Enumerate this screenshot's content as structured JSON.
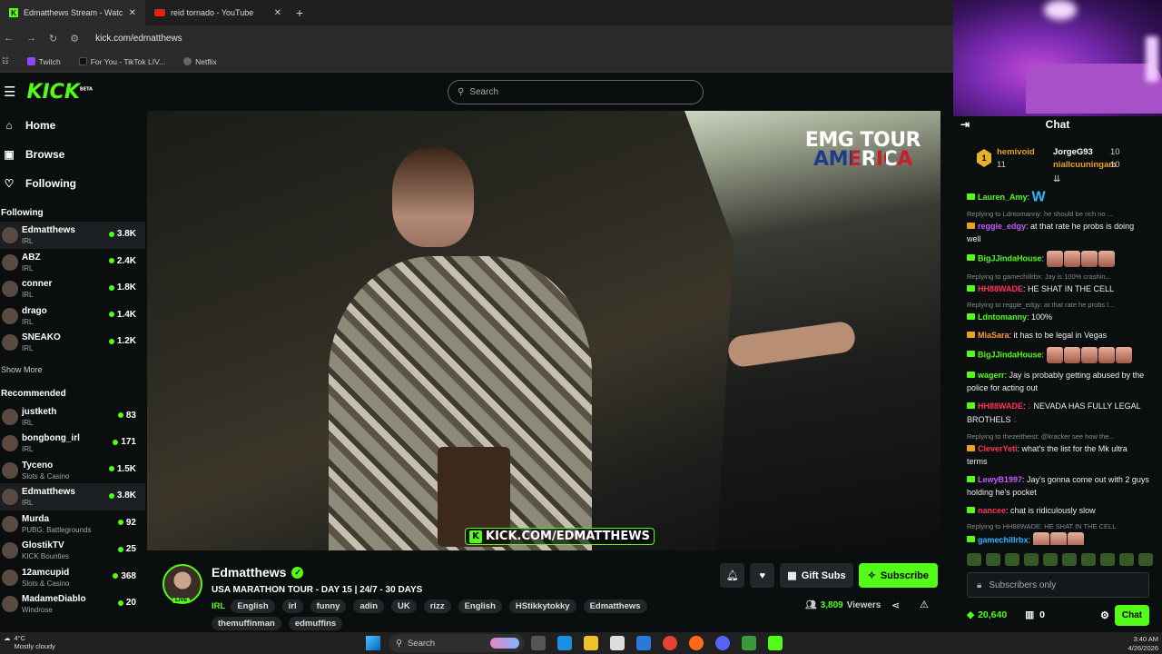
{
  "browser": {
    "tabs": [
      {
        "title": "Edmatthews Stream - Watc",
        "active": true
      },
      {
        "title": "reid tornado - YouTube",
        "active": false
      }
    ],
    "url": "kick.com/edmatthews",
    "bookmarks": [
      "Twitch",
      "For You - TikTok LIV...",
      "Netflix"
    ]
  },
  "kick": {
    "logo": "KICK",
    "logo_sup": "BETA",
    "search_placeholder": "Search"
  },
  "sidebar": {
    "nav": [
      {
        "label": "Home",
        "icon": "home-icon"
      },
      {
        "label": "Browse",
        "icon": "browse-icon"
      },
      {
        "label": "Following",
        "icon": "heart-icon"
      }
    ],
    "following_header": "Following",
    "following": [
      {
        "name": "Edmatthews",
        "category": "IRL",
        "viewers": "3.8K",
        "selected": true
      },
      {
        "name": "ABZ",
        "category": "IRL",
        "viewers": "2.4K"
      },
      {
        "name": "conner",
        "category": "IRL",
        "viewers": "1.8K"
      },
      {
        "name": "drago",
        "category": "IRL",
        "viewers": "1.4K"
      },
      {
        "name": "SNEAKO",
        "category": "IRL",
        "viewers": "1.2K"
      }
    ],
    "show_more": "Show More",
    "recommended_header": "Recommended",
    "recommended": [
      {
        "name": "justketh",
        "category": "IRL",
        "viewers": "83"
      },
      {
        "name": "bongbong_irl",
        "category": "IRL",
        "viewers": "171"
      },
      {
        "name": "Tyceno",
        "category": "Slots & Casino",
        "viewers": "1.5K"
      },
      {
        "name": "Edmatthews",
        "category": "IRL",
        "viewers": "3.8K",
        "selected": true
      },
      {
        "name": "Murda",
        "category": "PUBG: Battlegrounds",
        "viewers": "92"
      },
      {
        "name": "GlostikTV",
        "category": "KICK Bounties",
        "viewers": "25"
      },
      {
        "name": "12amcupid",
        "category": "Slots & Casino",
        "viewers": "368"
      },
      {
        "name": "MadameDiablo",
        "category": "Windrose",
        "viewers": "20"
      }
    ]
  },
  "video": {
    "overlay_line1": "EMG TOUR",
    "overlay_line2": "AMERICA",
    "watermark": "KICK.COM/EDMATTHEWS"
  },
  "channel": {
    "name": "Edmatthews",
    "live_badge": "LIVE",
    "stream_title": "USA MARATHON TOUR  - DAY 15 | 24/7 - 30 DAYS",
    "category": "IRL",
    "tags": [
      "English",
      "irl",
      "funny",
      "adin",
      "UK",
      "rizz",
      "English",
      "HStikkytokky",
      "Edmatthews",
      "themuffinman",
      "edmuffins"
    ],
    "viewers": "3,809",
    "viewers_label": "Viewers",
    "gift_label": "Gift Subs",
    "subscribe_label": "Subscribe"
  },
  "chat": {
    "title": "Chat",
    "leaderboard": [
      {
        "rank": "1",
        "user": "hemivoid",
        "count": "11"
      },
      {
        "user": "JorgeG93",
        "count": "10"
      },
      {
        "user": "niallcuuningam",
        "count": "10"
      }
    ],
    "messages": [
      {
        "user": "Lauren_Amy",
        "color": "#53fc18",
        "text": "",
        "emote": "W"
      },
      {
        "reply": "Replying to Ldntomanny: he should be rich no ...",
        "user": "reggie_edgy",
        "color": "#c45cff",
        "text": "at that rate he probs is doing well"
      },
      {
        "user": "BigJJindaHouse",
        "color": "#53fc18",
        "text": "",
        "emotes": 4
      },
      {
        "reply": "Replying to gamechillrbx: Jay is 100% crashin...",
        "user": "HH88WADE",
        "color": "#ff3355",
        "text": "HE SHAT IN THE CELL"
      },
      {
        "reply": "Replying to reggie_edgy: at that rate he probs l...",
        "user": "Ldntomanny",
        "color": "#53fc18",
        "text": "100%"
      },
      {
        "user": "MiaSara",
        "color": "#ff9a3c",
        "text": "it has to be legal in Vegas"
      },
      {
        "user": "BigJJindaHouse",
        "color": "#53fc18",
        "text": "",
        "emotes": 5
      },
      {
        "user": "wagerr",
        "color": "#53fc18",
        "text": "Jay is probably getting abused by the police for acting out"
      },
      {
        "user": "HH88WADE",
        "color": "#ff3355",
        "text": "NEVADA HAS FULLY LEGAL BROTHELS",
        "drops": true
      },
      {
        "reply": "Replying to thezeitheist: @kracker see how the...",
        "user": "CleverYeti",
        "color": "#ff3355",
        "text": "what's the list for the Mk ultra terms"
      },
      {
        "user": "LewyB1997",
        "color": "#c45cff",
        "text": "Jay's gonna come out with 2 guys holding he's pocket"
      },
      {
        "user": "nancee",
        "color": "#ff3355",
        "text": "chat is ridiculously slow"
      },
      {
        "reply": "Replying to HH88WADE: HE SHAT IN THE CELL",
        "user": "gamechillrbx",
        "color": "#2db8ff",
        "text": "",
        "emotes": 3
      }
    ],
    "input_placeholder": "Subscribers only",
    "kicks": "20,640",
    "gifts": "0",
    "send_label": "Chat"
  },
  "taskbar": {
    "temp": "4°C",
    "weather": "Mostly cloudy",
    "search": "Search",
    "time": "3:40 AM",
    "date": "4/26/2026"
  }
}
